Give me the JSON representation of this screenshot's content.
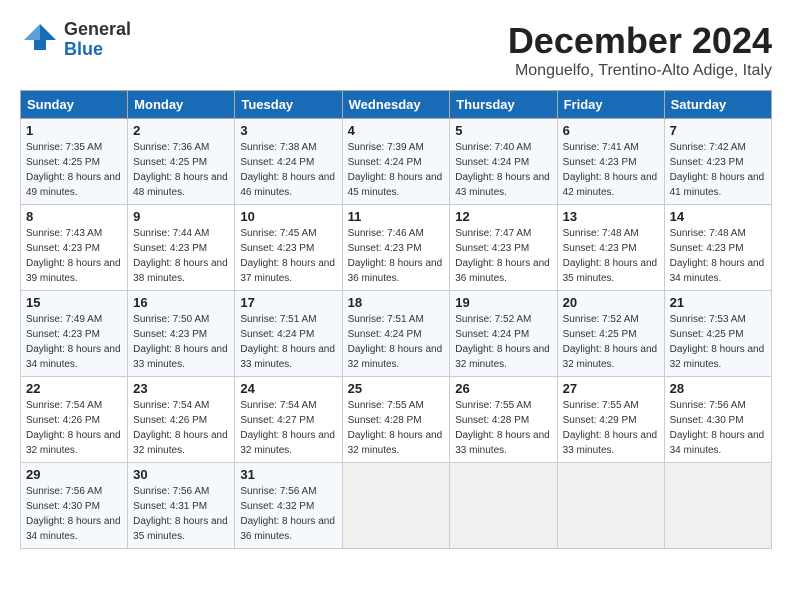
{
  "header": {
    "logo_general": "General",
    "logo_blue": "Blue",
    "month_title": "December 2024",
    "subtitle": "Monguelfo, Trentino-Alto Adige, Italy"
  },
  "days_of_week": [
    "Sunday",
    "Monday",
    "Tuesday",
    "Wednesday",
    "Thursday",
    "Friday",
    "Saturday"
  ],
  "weeks": [
    [
      {
        "day": "1",
        "sunrise": "Sunrise: 7:35 AM",
        "sunset": "Sunset: 4:25 PM",
        "daylight": "Daylight: 8 hours and 49 minutes."
      },
      {
        "day": "2",
        "sunrise": "Sunrise: 7:36 AM",
        "sunset": "Sunset: 4:25 PM",
        "daylight": "Daylight: 8 hours and 48 minutes."
      },
      {
        "day": "3",
        "sunrise": "Sunrise: 7:38 AM",
        "sunset": "Sunset: 4:24 PM",
        "daylight": "Daylight: 8 hours and 46 minutes."
      },
      {
        "day": "4",
        "sunrise": "Sunrise: 7:39 AM",
        "sunset": "Sunset: 4:24 PM",
        "daylight": "Daylight: 8 hours and 45 minutes."
      },
      {
        "day": "5",
        "sunrise": "Sunrise: 7:40 AM",
        "sunset": "Sunset: 4:24 PM",
        "daylight": "Daylight: 8 hours and 43 minutes."
      },
      {
        "day": "6",
        "sunrise": "Sunrise: 7:41 AM",
        "sunset": "Sunset: 4:23 PM",
        "daylight": "Daylight: 8 hours and 42 minutes."
      },
      {
        "day": "7",
        "sunrise": "Sunrise: 7:42 AM",
        "sunset": "Sunset: 4:23 PM",
        "daylight": "Daylight: 8 hours and 41 minutes."
      }
    ],
    [
      {
        "day": "8",
        "sunrise": "Sunrise: 7:43 AM",
        "sunset": "Sunset: 4:23 PM",
        "daylight": "Daylight: 8 hours and 39 minutes."
      },
      {
        "day": "9",
        "sunrise": "Sunrise: 7:44 AM",
        "sunset": "Sunset: 4:23 PM",
        "daylight": "Daylight: 8 hours and 38 minutes."
      },
      {
        "day": "10",
        "sunrise": "Sunrise: 7:45 AM",
        "sunset": "Sunset: 4:23 PM",
        "daylight": "Daylight: 8 hours and 37 minutes."
      },
      {
        "day": "11",
        "sunrise": "Sunrise: 7:46 AM",
        "sunset": "Sunset: 4:23 PM",
        "daylight": "Daylight: 8 hours and 36 minutes."
      },
      {
        "day": "12",
        "sunrise": "Sunrise: 7:47 AM",
        "sunset": "Sunset: 4:23 PM",
        "daylight": "Daylight: 8 hours and 36 minutes."
      },
      {
        "day": "13",
        "sunrise": "Sunrise: 7:48 AM",
        "sunset": "Sunset: 4:23 PM",
        "daylight": "Daylight: 8 hours and 35 minutes."
      },
      {
        "day": "14",
        "sunrise": "Sunrise: 7:48 AM",
        "sunset": "Sunset: 4:23 PM",
        "daylight": "Daylight: 8 hours and 34 minutes."
      }
    ],
    [
      {
        "day": "15",
        "sunrise": "Sunrise: 7:49 AM",
        "sunset": "Sunset: 4:23 PM",
        "daylight": "Daylight: 8 hours and 34 minutes."
      },
      {
        "day": "16",
        "sunrise": "Sunrise: 7:50 AM",
        "sunset": "Sunset: 4:23 PM",
        "daylight": "Daylight: 8 hours and 33 minutes."
      },
      {
        "day": "17",
        "sunrise": "Sunrise: 7:51 AM",
        "sunset": "Sunset: 4:24 PM",
        "daylight": "Daylight: 8 hours and 33 minutes."
      },
      {
        "day": "18",
        "sunrise": "Sunrise: 7:51 AM",
        "sunset": "Sunset: 4:24 PM",
        "daylight": "Daylight: 8 hours and 32 minutes."
      },
      {
        "day": "19",
        "sunrise": "Sunrise: 7:52 AM",
        "sunset": "Sunset: 4:24 PM",
        "daylight": "Daylight: 8 hours and 32 minutes."
      },
      {
        "day": "20",
        "sunrise": "Sunrise: 7:52 AM",
        "sunset": "Sunset: 4:25 PM",
        "daylight": "Daylight: 8 hours and 32 minutes."
      },
      {
        "day": "21",
        "sunrise": "Sunrise: 7:53 AM",
        "sunset": "Sunset: 4:25 PM",
        "daylight": "Daylight: 8 hours and 32 minutes."
      }
    ],
    [
      {
        "day": "22",
        "sunrise": "Sunrise: 7:54 AM",
        "sunset": "Sunset: 4:26 PM",
        "daylight": "Daylight: 8 hours and 32 minutes."
      },
      {
        "day": "23",
        "sunrise": "Sunrise: 7:54 AM",
        "sunset": "Sunset: 4:26 PM",
        "daylight": "Daylight: 8 hours and 32 minutes."
      },
      {
        "day": "24",
        "sunrise": "Sunrise: 7:54 AM",
        "sunset": "Sunset: 4:27 PM",
        "daylight": "Daylight: 8 hours and 32 minutes."
      },
      {
        "day": "25",
        "sunrise": "Sunrise: 7:55 AM",
        "sunset": "Sunset: 4:28 PM",
        "daylight": "Daylight: 8 hours and 32 minutes."
      },
      {
        "day": "26",
        "sunrise": "Sunrise: 7:55 AM",
        "sunset": "Sunset: 4:28 PM",
        "daylight": "Daylight: 8 hours and 33 minutes."
      },
      {
        "day": "27",
        "sunrise": "Sunrise: 7:55 AM",
        "sunset": "Sunset: 4:29 PM",
        "daylight": "Daylight: 8 hours and 33 minutes."
      },
      {
        "day": "28",
        "sunrise": "Sunrise: 7:56 AM",
        "sunset": "Sunset: 4:30 PM",
        "daylight": "Daylight: 8 hours and 34 minutes."
      }
    ],
    [
      {
        "day": "29",
        "sunrise": "Sunrise: 7:56 AM",
        "sunset": "Sunset: 4:30 PM",
        "daylight": "Daylight: 8 hours and 34 minutes."
      },
      {
        "day": "30",
        "sunrise": "Sunrise: 7:56 AM",
        "sunset": "Sunset: 4:31 PM",
        "daylight": "Daylight: 8 hours and 35 minutes."
      },
      {
        "day": "31",
        "sunrise": "Sunrise: 7:56 AM",
        "sunset": "Sunset: 4:32 PM",
        "daylight": "Daylight: 8 hours and 36 minutes."
      },
      null,
      null,
      null,
      null
    ]
  ]
}
